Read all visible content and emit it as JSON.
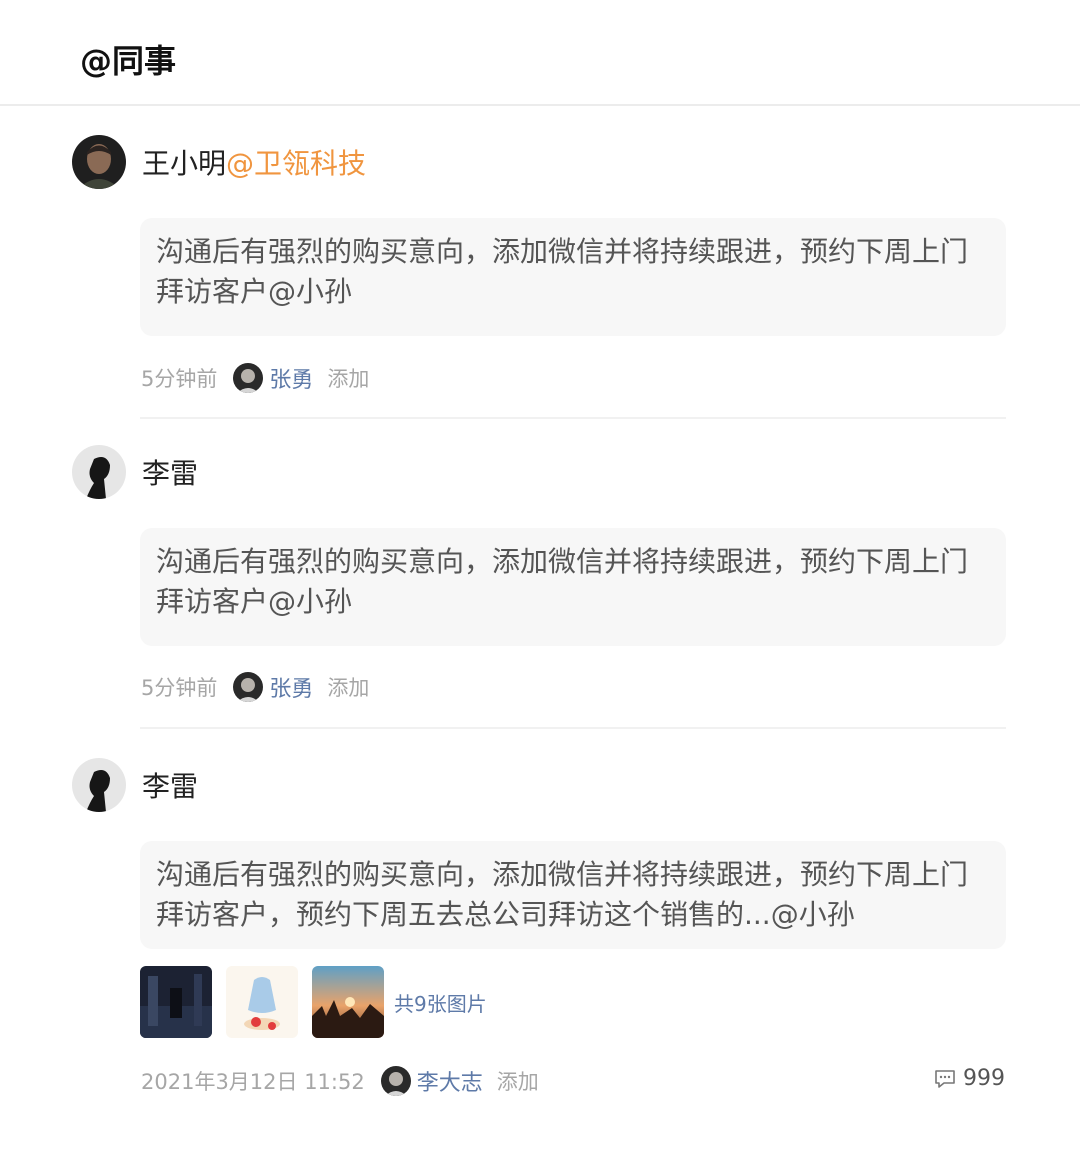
{
  "header": {
    "title": "@同事"
  },
  "items": [
    {
      "author": "王小明",
      "company": "@卫瓴科技",
      "text": "沟通后有强烈的购买意向，添加微信并将持续跟进，预约下周上门拜访客户@小孙",
      "time": "5分钟前",
      "operator": "张勇",
      "action": "添加"
    },
    {
      "author": "李雷",
      "company": "",
      "text": "沟通后有强烈的购买意向，添加微信并将持续跟进，预约下周上门拜访客户@小孙",
      "time": "5分钟前",
      "operator": "张勇",
      "action": "添加"
    },
    {
      "author": "李雷",
      "company": "",
      "text": "沟通后有强烈的购买意向，添加微信并将持续跟进，预约下周上门拜访客户，预约下周五去总公司拜访这个销售的...@小孙",
      "images_label": "共9张图片",
      "time": "2021年3月12日 11:52",
      "operator": "李大志",
      "action": "添加",
      "comment_count": "999"
    }
  ],
  "icons": {
    "comment": "comment-icon",
    "avatar": "avatar"
  },
  "colors": {
    "company": "#f0953f",
    "operator": "#5e7aa8",
    "bubble": "#f7f7f7"
  }
}
